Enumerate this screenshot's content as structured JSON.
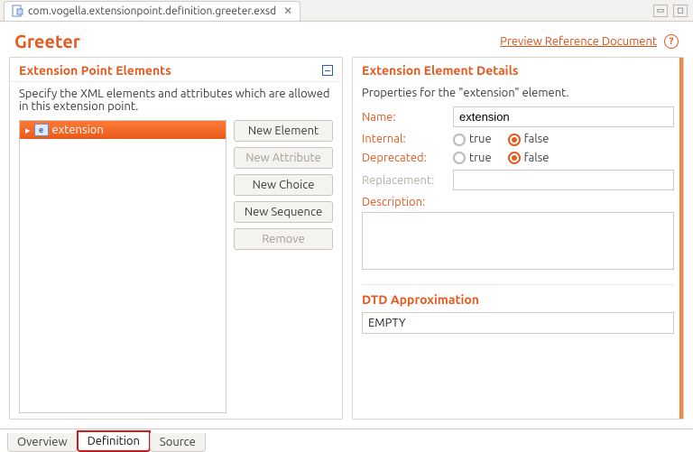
{
  "tab": {
    "filename": "com.vogella.extensionpoint.definition.greeter.exsd"
  },
  "header": {
    "title": "Greeter",
    "preview_link": "Preview Reference Document"
  },
  "left": {
    "title": "Extension Point Elements",
    "desc": "Specify the XML elements and attributes which are allowed in this extension point.",
    "tree": {
      "items": [
        {
          "label": "extension"
        }
      ]
    },
    "buttons": {
      "new_element": "New Element",
      "new_attribute": "New Attribute",
      "new_choice": "New Choice",
      "new_sequence": "New Sequence",
      "remove": "Remove"
    }
  },
  "right": {
    "title": "Extension Element Details",
    "subtitle": "Properties for the \"extension\" element.",
    "labels": {
      "name": "Name:",
      "internal": "Internal:",
      "deprecated": "Deprecated:",
      "replacement": "Replacement:",
      "description": "Description:",
      "dtd": "DTD Approximation"
    },
    "values": {
      "name": "extension",
      "true": "true",
      "false": "false",
      "dtd": "EMPTY"
    }
  },
  "bottom_tabs": {
    "overview": "Overview",
    "definition": "Definition",
    "source": "Source"
  }
}
